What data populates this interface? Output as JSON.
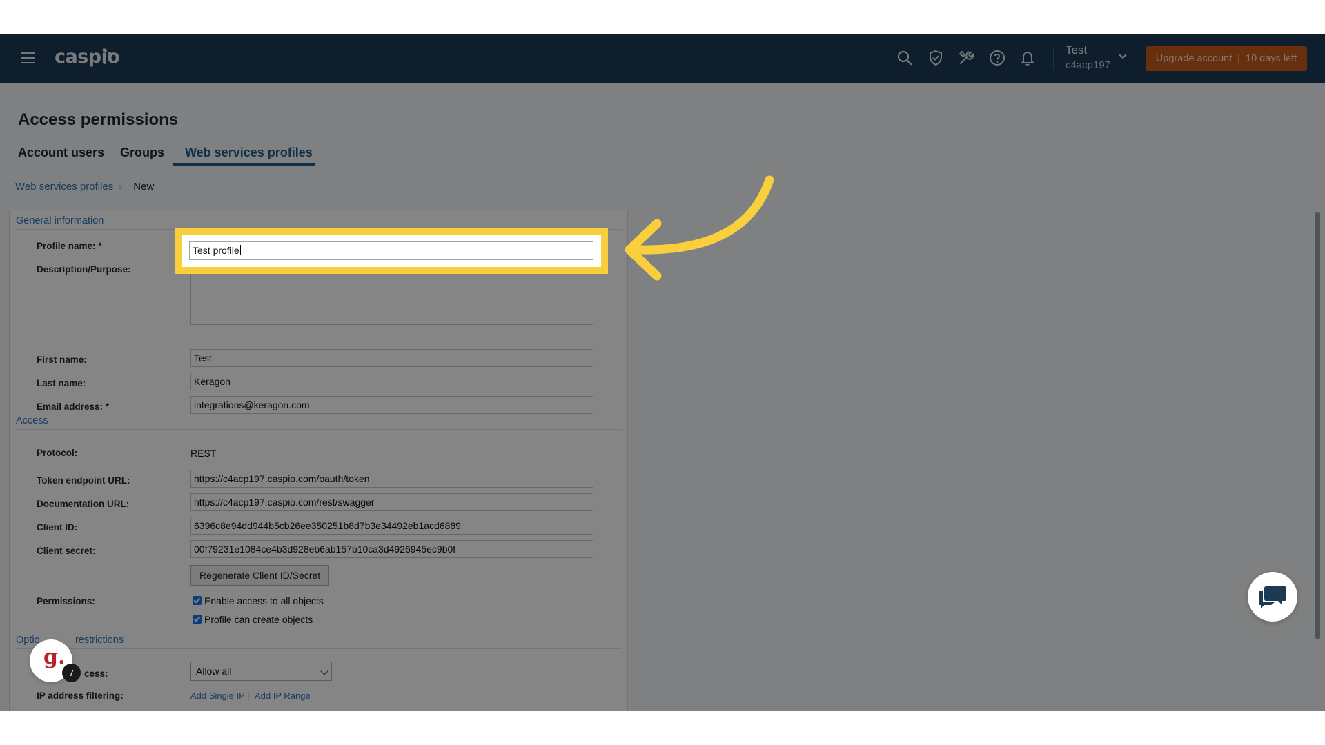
{
  "header": {
    "logo": "caspio",
    "user_name": "Test",
    "account_id": "c4acp197",
    "upgrade_label": "Upgrade account",
    "trial_label": "10 days left",
    "icons": [
      "search-icon",
      "shield-check-icon",
      "wrench-icon",
      "help-icon",
      "bell-icon",
      "chevron-down-icon"
    ]
  },
  "page": {
    "title": "Access permissions",
    "tabs": [
      {
        "label": "Account users",
        "active": false
      },
      {
        "label": "Groups",
        "active": false
      },
      {
        "label": "Web services profiles",
        "active": true
      }
    ],
    "breadcrumb": {
      "parent": "Web services profiles",
      "current": "New"
    }
  },
  "form": {
    "general_section": "General information",
    "profile_name_label": "Profile name: *",
    "profile_name_value": "Test profile",
    "description_label": "Description/Purpose:",
    "first_name_label": "First name:",
    "first_name_value": "Test",
    "last_name_label": "Last name:",
    "last_name_value": "Keragon",
    "email_label": "Email address: *",
    "email_value": "integrations@keragon.com",
    "access_section": "Access",
    "protocol_label": "Protocol:",
    "protocol_value": "REST",
    "token_label": "Token endpoint URL:",
    "token_value": "https://c4acp197.caspio.com/oauth/token",
    "doc_label": "Documentation URL:",
    "doc_value": "https://c4acp197.caspio.com/rest/swagger",
    "client_id_label": "Client ID:",
    "client_id_value": "6396c8e94dd944b5cb26ee350251b8d7b3e34492eb1acd6889",
    "client_secret_label": "Client secret:",
    "client_secret_value": "00f79231e1084ce4b3d928eb6ab157b10ca3d4926945ec9b0f",
    "regenerate_label": "Regenerate Client ID/Secret",
    "permissions_label": "Permissions:",
    "perm_all_objects": "Enable access to all objects",
    "perm_create_objects": "Profile can create objects",
    "ip_section_start": "Optio",
    "ip_section_end": "restrictions",
    "ip_access_label_end": "cess:",
    "ip_access_value": "Allow all",
    "ip_filter_label": "IP address filtering:",
    "add_single_ip": "Add Single IP",
    "link_sep": "|",
    "add_ip_range": "Add IP Range"
  },
  "overlay_badge": {
    "letter": "g.",
    "count": "7"
  },
  "colors": {
    "header_bg": "#1d3a55",
    "upgrade_bg": "#c75b1c",
    "highlight": "#f9cf3e",
    "link": "#2e74b5"
  }
}
